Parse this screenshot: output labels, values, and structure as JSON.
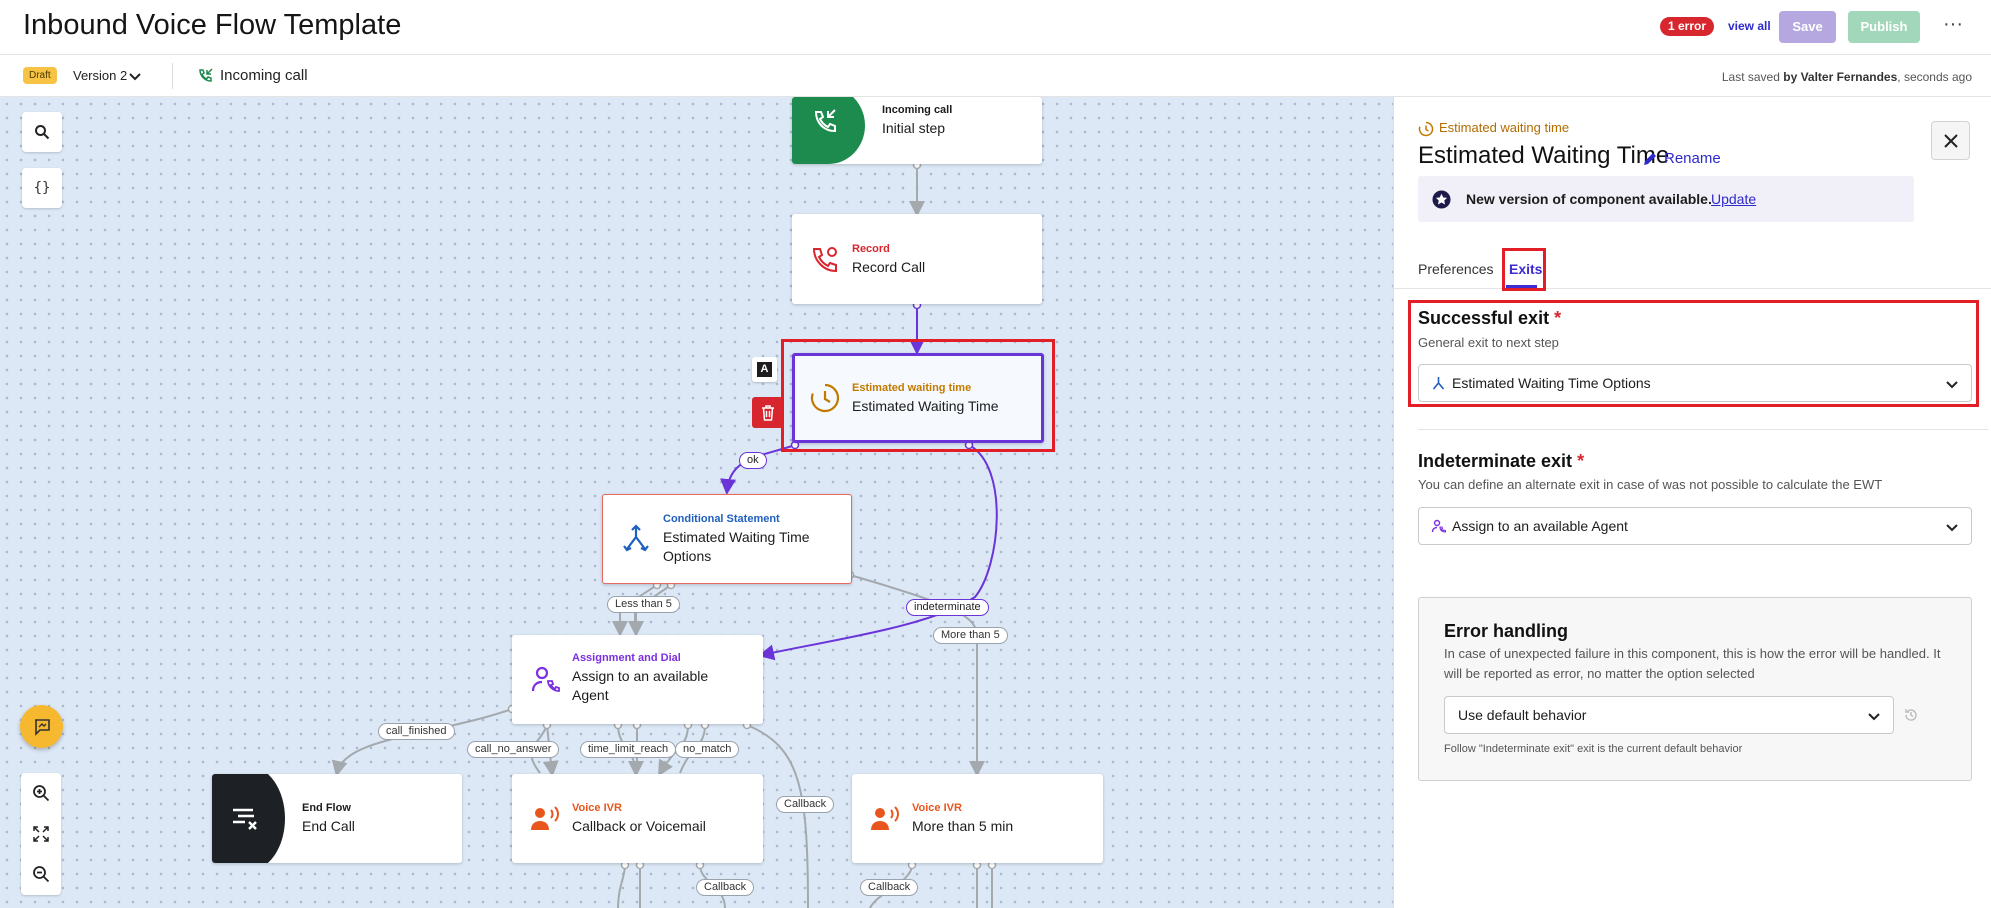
{
  "header": {
    "title": "Inbound Voice Flow Template",
    "error_badge": "1 error",
    "view_all": "view all",
    "save_label": "Save",
    "publish_label": "Publish",
    "more_label": "···"
  },
  "subheader": {
    "status_badge": "Draft",
    "version_label": "Version 2",
    "trigger_label": "Incoming call",
    "last_saved_prefix": "Last saved ",
    "last_saved_by": "by Valter Fernandes",
    "last_saved_suffix": ", seconds ago"
  },
  "canvas": {
    "tools": {
      "search_icon": "search-icon",
      "variables_label": "{}"
    },
    "node_actions": {
      "rename_label": "A",
      "delete_icon": "trash-icon"
    },
    "nodes": [
      {
        "id": "incoming",
        "type": "Incoming call",
        "name": "Initial step",
        "type_color": "#1c1c1c",
        "icon": "incoming-call-icon"
      },
      {
        "id": "record",
        "type": "Record",
        "name": "Record Call",
        "type_color": "#d8262e",
        "icon": "record-call-icon"
      },
      {
        "id": "ewt",
        "type": "Estimated waiting time",
        "name": "Estimated Waiting Time",
        "type_color": "#c17a00",
        "icon": "clock-icon"
      },
      {
        "id": "cond",
        "type": "Conditional Statement",
        "name": "Estimated Waiting Time Options",
        "type_color": "#1f5fbf",
        "icon": "branch-icon"
      },
      {
        "id": "assign",
        "type": "Assignment and Dial",
        "name": "Assign to an available Agent",
        "type_color": "#7c2fe0",
        "icon": "agent-dial-icon"
      },
      {
        "id": "end",
        "type": "End Flow",
        "name": "End Call",
        "type_color": "#1c1c1c",
        "icon": "end-flow-icon"
      },
      {
        "id": "ivr1",
        "type": "Voice IVR",
        "name": "Callback or Voicemail",
        "type_color": "#e8561e",
        "icon": "voice-ivr-icon"
      },
      {
        "id": "ivr2",
        "type": "Voice IVR",
        "name": "More than 5 min",
        "type_color": "#e8561e",
        "icon": "voice-ivr-icon"
      }
    ],
    "edge_labels": {
      "ok": "ok",
      "less_than_5": "Less than 5",
      "indeterminate": "indeterminate",
      "more_than_5": "More than 5",
      "call_finished": "call_finished",
      "call_no_answer": "call_no_answer",
      "time_limit_reach": "time_limit_reach",
      "no_match": "no_match",
      "callback_1": "Callback",
      "callback_2": "Callback",
      "callback_3": "Callback"
    }
  },
  "panel": {
    "component_type": "Estimated waiting time",
    "title": "Estimated Waiting Time",
    "rename_label": "Rename",
    "notice_text": "New version of component available.",
    "notice_link": "Update",
    "tabs": [
      {
        "label": "Preferences",
        "active": false
      },
      {
        "label": "Exits",
        "active": true
      }
    ],
    "successful_exit": {
      "title": "Successful exit",
      "required": "*",
      "description": "General exit to next step",
      "value": "Estimated Waiting Time Options"
    },
    "indeterminate_exit": {
      "title": "Indeterminate exit",
      "required": "*",
      "description": "You can define an alternate exit in case of was not possible to calculate the EWT",
      "value": "Assign to an available Agent"
    },
    "error_handling": {
      "title": "Error handling",
      "description": "In case of unexpected failure in this component, this is how the error will be handled. It will be reported as error, no matter the option selected",
      "value": "Use default behavior",
      "hint": "Follow \"Indeterminate exit\" exit is the current default behavior"
    }
  },
  "colors": {
    "accent": "#3b2dd1",
    "selected_edge": "#6b34d9",
    "error": "#d8262e",
    "highlight": "#e21f26",
    "canvas_bg": "#dce8f6"
  }
}
